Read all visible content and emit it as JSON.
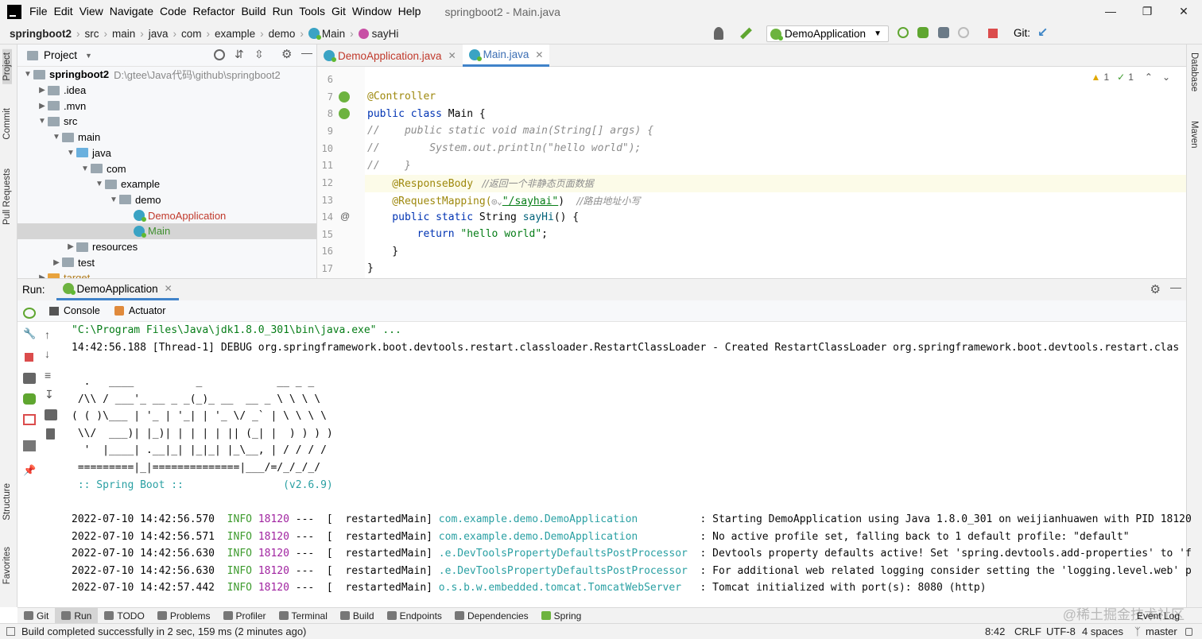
{
  "menu": {
    "items": [
      "File",
      "Edit",
      "View",
      "Navigate",
      "Code",
      "Refactor",
      "Build",
      "Run",
      "Tools",
      "Git",
      "Window",
      "Help"
    ],
    "title": "springboot2 - Main.java"
  },
  "breadcrumb": [
    "springboot2",
    "src",
    "main",
    "java",
    "com",
    "example",
    "demo",
    "Main",
    "sayHi"
  ],
  "toolbar": {
    "run_config": "DemoApplication",
    "git_label": "Git:"
  },
  "project": {
    "header": "Project",
    "root": "springboot2",
    "root_path": "D:\\gtee\\Java代码\\github\\springboot2",
    "items": [
      {
        "label": ".idea"
      },
      {
        "label": ".mvn"
      },
      {
        "label": "src"
      },
      {
        "label": "main"
      },
      {
        "label": "java"
      },
      {
        "label": "com"
      },
      {
        "label": "example"
      },
      {
        "label": "demo"
      },
      {
        "label": "DemoApplication"
      },
      {
        "label": "Main"
      },
      {
        "label": "resources"
      },
      {
        "label": "test"
      },
      {
        "label": "target"
      }
    ]
  },
  "editor": {
    "tabs": [
      "DemoApplication.java",
      "Main.java"
    ],
    "inspections": {
      "warnings": "1",
      "ok": "1"
    },
    "lines": [
      "6",
      "7",
      "8",
      "9",
      "10",
      "11",
      "12",
      "13",
      "14",
      "15",
      "16",
      "17"
    ],
    "code": {
      "l7": "@Controller",
      "l8a": "public class ",
      "l8b": "Main {",
      "l9": "//    public static void main(String[] args) {",
      "l10": "//        System.out.println(\"hello world\");",
      "l11": "//    }",
      "l12a": "    @ResponseBody",
      "l12b": "   //返回一个非静态页面数据",
      "l13a": "    @RequestMapping(",
      "l13b": "\"/sayhai\"",
      "l13c": ")",
      "l13d": "    //路由地址小写",
      "l14a": "    public static ",
      "l14b": "String ",
      "l14c": "sayHi",
      "l14d": "() {",
      "l15a": "        return ",
      "l15b": "\"hello world\"",
      "l15c": ";",
      "l16": "    }",
      "l17": "}"
    }
  },
  "run": {
    "label": "Run:",
    "tab": "DemoApplication",
    "subtabs": [
      "Console",
      "Actuator"
    ],
    "console": {
      "java_cmd": "\"C:\\Program Files\\Java\\jdk1.8.0_301\\bin\\java.exe\" ...",
      "debug_line": "14:42:56.188 [Thread-1] DEBUG org.springframework.boot.devtools.restart.classloader.RestartClassLoader - Created RestartClassLoader org.springframework.boot.devtools.restart.clas",
      "banner": [
        "  .   ____          _            __ _ _",
        " /\\\\ / ___'_ __ _ _(_)_ __  __ _ \\ \\ \\ \\",
        "( ( )\\___ | '_ | '_| | '_ \\/ _` | \\ \\ \\ \\",
        " \\\\/  ___)| |_)| | | | | || (_| |  ) ) ) )",
        "  '  |____| .__|_| |_|_| |_\\__, | / / / /",
        " =========|_|==============|___/=/_/_/_/"
      ],
      "spring_boot": " :: Spring Boot ::                (v2.6.9)",
      "logs": [
        {
          "ts": "2022-07-10 14:42:56.570",
          "level": "INFO",
          "pid": "18120",
          "thread": "---  [  restartedMain]",
          "logger": "com.example.demo.DemoApplication         ",
          "msg": ": Starting DemoApplication using Java 1.8.0_301 on weijianhuawen with PID 18120"
        },
        {
          "ts": "2022-07-10 14:42:56.571",
          "level": "INFO",
          "pid": "18120",
          "thread": "---  [  restartedMain]",
          "logger": "com.example.demo.DemoApplication         ",
          "msg": ": No active profile set, falling back to 1 default profile: \"default\""
        },
        {
          "ts": "2022-07-10 14:42:56.630",
          "level": "INFO",
          "pid": "18120",
          "thread": "---  [  restartedMain]",
          "logger": ".e.DevToolsPropertyDefaultsPostProcessor ",
          "msg": ": Devtools property defaults active! Set 'spring.devtools.add-properties' to 'f"
        },
        {
          "ts": "2022-07-10 14:42:56.630",
          "level": "INFO",
          "pid": "18120",
          "thread": "---  [  restartedMain]",
          "logger": ".e.DevToolsPropertyDefaultsPostProcessor ",
          "msg": ": For additional web related logging consider setting the 'logging.level.web' p"
        },
        {
          "ts": "2022-07-10 14:42:57.442",
          "level": "INFO",
          "pid": "18120",
          "thread": "---  [  restartedMain]",
          "logger": "o.s.b.w.embedded.tomcat.TomcatWebServer  ",
          "msg": ": Tomcat initialized with port(s): 8080 (http)"
        }
      ]
    }
  },
  "bottom_tabs": [
    "Git",
    "Run",
    "TODO",
    "Problems",
    "Profiler",
    "Terminal",
    "Build",
    "Endpoints",
    "Dependencies",
    "Spring"
  ],
  "event_log": "Event Log",
  "left_strip": [
    "Project",
    "Commit",
    "Pull Requests",
    "Structure",
    "Favorites"
  ],
  "right_strip": [
    "Database",
    "Maven"
  ],
  "status": {
    "message": "Build completed successfully in 2 sec, 159 ms (2 minutes ago)",
    "position": "8:42",
    "line_sep": "CRLF",
    "encoding": "UTF-8",
    "indent": "4 spaces",
    "branch": "master"
  },
  "watermark": "@稀土掘金技术社区"
}
